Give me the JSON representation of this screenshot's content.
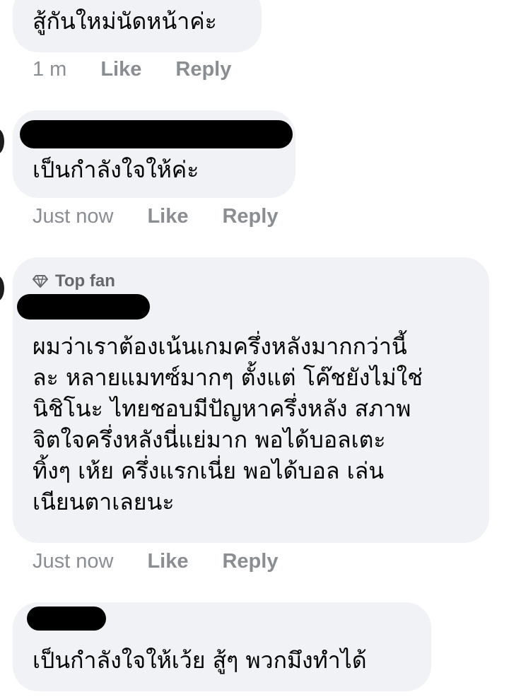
{
  "comments": [
    {
      "text": "สู้กันใหม่นัดหน้าค่ะ",
      "time": "1 m",
      "like": "Like",
      "reply": "Reply"
    },
    {
      "text": "เป็นกำลังใจให้ค่ะ",
      "time": "Just now",
      "like": "Like",
      "reply": "Reply"
    },
    {
      "badge": "Top fan",
      "badge_icon": "diamond-icon",
      "text": "ผมว่าเราต้องเน้นเกมครึ่งหลังมากกว่านี้\nละ หลายแมทซ์มากๆ ตั้งแต่ โค๊ชยังไม่ใช่\nนิชิโนะ ไทยชอบมีปัญหาครึ่งหลัง สภาพ\nจิตใจครึ่งหลังนี่แย่มาก พอได้บอลเตะ\nทิ้งๆ เห้ย ครึ่งแรกเนี่ย พอได้บอล เล่น\nเนียนตาเลยนะ",
      "time": "Just now",
      "like": "Like",
      "reply": "Reply"
    },
    {
      "text": "เป็นกำลังใจให้เว้ย สู้ๆ พวกมึงทำได้"
    }
  ],
  "colors": {
    "bubble": "#f0f2f5",
    "meta": "#8a8d91",
    "text": "#050505",
    "redaction": "#000000"
  }
}
